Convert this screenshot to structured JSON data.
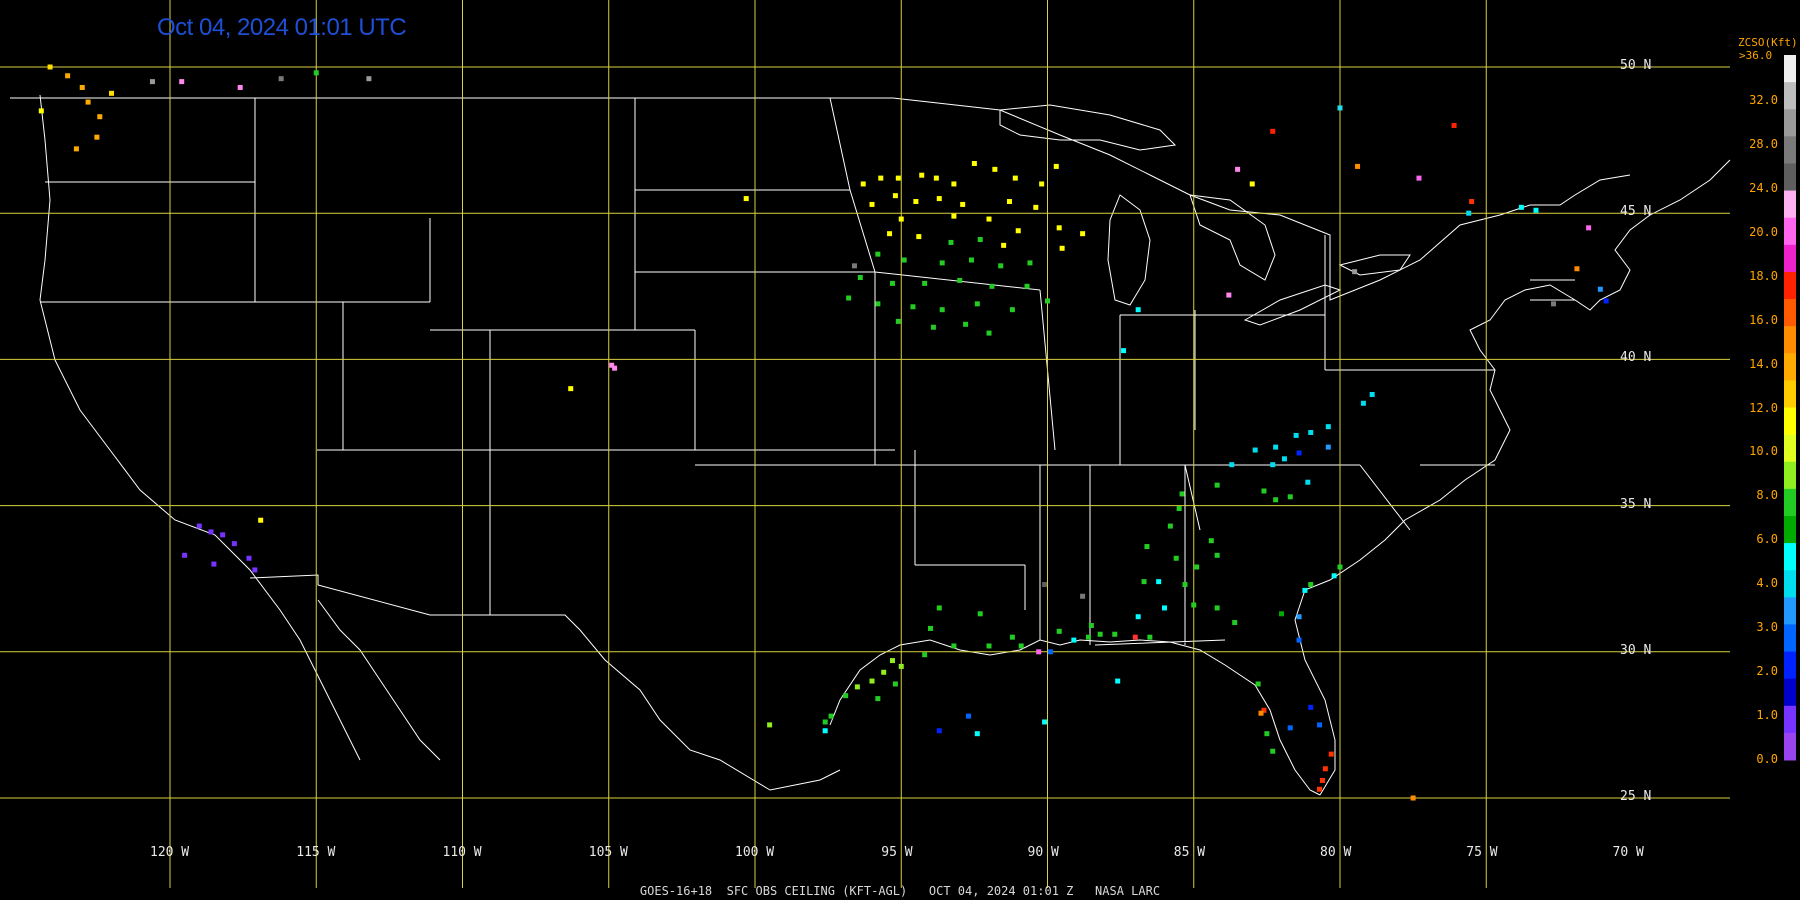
{
  "timestamp": "Oct 04, 2024 01:01 UTC",
  "footer": "GOES-16+18  SFC OBS CEILING (KFT-AGL)   OCT 04, 2024 01:01 Z   NASA LARC",
  "lat_labels": [
    "50 N",
    "45 N",
    "40 N",
    "35 N",
    "30 N",
    "25 N"
  ],
  "lon_labels": [
    "120 W",
    "115 W",
    "110 W",
    "105 W",
    "100 W",
    "95 W",
    "90 W",
    "85 W",
    "80 W",
    "75 W",
    "70 W"
  ],
  "colorbar": {
    "title": "ZCSO(Kft)",
    "top_label": ">36.0",
    "labels": [
      "32.0",
      "28.0",
      "24.0",
      "20.0",
      "18.0",
      "16.0",
      "14.0",
      "12.0",
      "10.0",
      "8.0",
      "6.0",
      "4.0",
      "3.0",
      "2.0",
      "1.0",
      "0.0"
    ],
    "segment_colors": [
      "#efefef",
      "#bdbdbd",
      "#9a9a9a",
      "#7a7a7a",
      "#5e5e5e",
      "#ffb0f0",
      "#ff66ee",
      "#ee22cc",
      "#ff2200",
      "#ff5a00",
      "#ff8c00",
      "#ffaa00",
      "#ffcc00",
      "#ffff00",
      "#e0ff20",
      "#90ee20",
      "#22cc22",
      "#00aa00",
      "#00ffff",
      "#00ddee",
      "#2299ff",
      "#0066ff",
      "#0022ff",
      "#0000cc",
      "#7733ff",
      "#9944ee"
    ]
  },
  "colors": {
    "grid": "#d9d13f",
    "boundary": "#ffffff",
    "timestamp": "#1e4fd6",
    "scale_text": "#ffa500"
  },
  "observations": [
    {
      "lon": -124.1,
      "lat": 50.0,
      "color": "#ffdd00"
    },
    {
      "lon": -123.5,
      "lat": 49.7,
      "color": "#ffaa00"
    },
    {
      "lon": -123.0,
      "lat": 49.3,
      "color": "#ffaa00"
    },
    {
      "lon": -122.8,
      "lat": 48.8,
      "color": "#ffaa00"
    },
    {
      "lon": -122.4,
      "lat": 48.3,
      "color": "#ffaa00"
    },
    {
      "lon": -122.5,
      "lat": 47.6,
      "color": "#ffaa00"
    },
    {
      "lon": -123.2,
      "lat": 47.2,
      "color": "#ffaa00"
    },
    {
      "lon": -122.0,
      "lat": 49.1,
      "color": "#ffdd00"
    },
    {
      "lon": -124.4,
      "lat": 48.5,
      "color": "#ffff00"
    },
    {
      "lon": -120.6,
      "lat": 49.5,
      "color": "#9a9a9a"
    },
    {
      "lon": -119.6,
      "lat": 49.5,
      "color": "#ff88ee"
    },
    {
      "lon": -117.6,
      "lat": 49.3,
      "color": "#ff88ee"
    },
    {
      "lon": -116.2,
      "lat": 49.6,
      "color": "#7a7a7a"
    },
    {
      "lon": -115.0,
      "lat": 49.8,
      "color": "#22cc22"
    },
    {
      "lon": -113.2,
      "lat": 49.6,
      "color": "#9a9a9a"
    },
    {
      "lon": -119.0,
      "lat": 34.3,
      "color": "#7733ff"
    },
    {
      "lon": -118.6,
      "lat": 34.1,
      "color": "#7733ff"
    },
    {
      "lon": -118.2,
      "lat": 34.0,
      "color": "#7733ff"
    },
    {
      "lon": -117.8,
      "lat": 33.7,
      "color": "#7733ff"
    },
    {
      "lon": -117.3,
      "lat": 33.2,
      "color": "#7733ff"
    },
    {
      "lon": -117.1,
      "lat": 32.8,
      "color": "#7733ff"
    },
    {
      "lon": -119.5,
      "lat": 33.3,
      "color": "#7733ff"
    },
    {
      "lon": -118.5,
      "lat": 33.0,
      "color": "#7733ff"
    },
    {
      "lon": -116.9,
      "lat": 34.5,
      "color": "#ffff00"
    },
    {
      "lon": -104.9,
      "lat": 39.8,
      "color": "#ff88ee"
    },
    {
      "lon": -104.8,
      "lat": 39.7,
      "color": "#ff88ee"
    },
    {
      "lon": -106.3,
      "lat": 39.0,
      "color": "#ffff00"
    },
    {
      "lon": -100.3,
      "lat": 45.5,
      "color": "#ffff00"
    },
    {
      "lon": -96.3,
      "lat": 46.0,
      "color": "#ffff00"
    },
    {
      "lon": -95.7,
      "lat": 46.2,
      "color": "#ffff00"
    },
    {
      "lon": -95.1,
      "lat": 46.2,
      "color": "#ffff00"
    },
    {
      "lon": -94.3,
      "lat": 46.3,
      "color": "#ffff00"
    },
    {
      "lon": -93.8,
      "lat": 46.2,
      "color": "#ffff00"
    },
    {
      "lon": -93.2,
      "lat": 46.0,
      "color": "#ffff00"
    },
    {
      "lon": -92.5,
      "lat": 46.7,
      "color": "#ffff00"
    },
    {
      "lon": -91.8,
      "lat": 46.5,
      "color": "#ffff00"
    },
    {
      "lon": -91.1,
      "lat": 46.2,
      "color": "#ffff00"
    },
    {
      "lon": -90.2,
      "lat": 46.0,
      "color": "#ffff00"
    },
    {
      "lon": -89.7,
      "lat": 46.6,
      "color": "#ffff00"
    },
    {
      "lon": -96.0,
      "lat": 45.3,
      "color": "#ffff00"
    },
    {
      "lon": -95.2,
      "lat": 45.6,
      "color": "#ffff00"
    },
    {
      "lon": -94.5,
      "lat": 45.4,
      "color": "#ffff00"
    },
    {
      "lon": -93.7,
      "lat": 45.5,
      "color": "#ffff00"
    },
    {
      "lon": -92.9,
      "lat": 45.3,
      "color": "#ffff00"
    },
    {
      "lon": -91.3,
      "lat": 45.4,
      "color": "#ffff00"
    },
    {
      "lon": -90.4,
      "lat": 45.2,
      "color": "#ffff00"
    },
    {
      "lon": -95.0,
      "lat": 44.8,
      "color": "#ffff00"
    },
    {
      "lon": -93.2,
      "lat": 44.9,
      "color": "#ffff00"
    },
    {
      "lon": -92.0,
      "lat": 44.8,
      "color": "#ffff00"
    },
    {
      "lon": -91.0,
      "lat": 44.4,
      "color": "#ffff00"
    },
    {
      "lon": -89.6,
      "lat": 44.5,
      "color": "#ffff00"
    },
    {
      "lon": -88.8,
      "lat": 44.3,
      "color": "#ffff00"
    },
    {
      "lon": -89.5,
      "lat": 43.8,
      "color": "#ffff00"
    },
    {
      "lon": -95.4,
      "lat": 44.3,
      "color": "#ffff00"
    },
    {
      "lon": -94.4,
      "lat": 44.2,
      "color": "#ffff00"
    },
    {
      "lon": -91.5,
      "lat": 43.9,
      "color": "#ffff00"
    },
    {
      "lon": -93.3,
      "lat": 44.0,
      "color": "#22cc22"
    },
    {
      "lon": -92.3,
      "lat": 44.1,
      "color": "#22cc22"
    },
    {
      "lon": -95.8,
      "lat": 43.6,
      "color": "#22cc22"
    },
    {
      "lon": -94.9,
      "lat": 43.4,
      "color": "#22cc22"
    },
    {
      "lon": -93.6,
      "lat": 43.3,
      "color": "#22cc22"
    },
    {
      "lon": -92.6,
      "lat": 43.4,
      "color": "#22cc22"
    },
    {
      "lon": -91.6,
      "lat": 43.2,
      "color": "#22cc22"
    },
    {
      "lon": -90.6,
      "lat": 43.3,
      "color": "#22cc22"
    },
    {
      "lon": -96.4,
      "lat": 42.8,
      "color": "#22cc22"
    },
    {
      "lon": -95.3,
      "lat": 42.6,
      "color": "#22cc22"
    },
    {
      "lon": -94.2,
      "lat": 42.6,
      "color": "#22cc22"
    },
    {
      "lon": -93.0,
      "lat": 42.7,
      "color": "#22cc22"
    },
    {
      "lon": -91.9,
      "lat": 42.5,
      "color": "#22cc22"
    },
    {
      "lon": -90.7,
      "lat": 42.5,
      "color": "#22cc22"
    },
    {
      "lon": -96.8,
      "lat": 42.1,
      "color": "#22cc22"
    },
    {
      "lon": -95.8,
      "lat": 41.9,
      "color": "#22cc22"
    },
    {
      "lon": -94.6,
      "lat": 41.8,
      "color": "#22cc22"
    },
    {
      "lon": -93.6,
      "lat": 41.7,
      "color": "#22cc22"
    },
    {
      "lon": -92.4,
      "lat": 41.9,
      "color": "#22cc22"
    },
    {
      "lon": -91.2,
      "lat": 41.7,
      "color": "#22cc22"
    },
    {
      "lon": -95.1,
      "lat": 41.3,
      "color": "#22cc22"
    },
    {
      "lon": -93.9,
      "lat": 41.1,
      "color": "#22cc22"
    },
    {
      "lon": -92.8,
      "lat": 41.2,
      "color": "#22cc22"
    },
    {
      "lon": -92.0,
      "lat": 40.9,
      "color": "#22cc22"
    },
    {
      "lon": -96.6,
      "lat": 43.2,
      "color": "#7a7a7a"
    },
    {
      "lon": -90.0,
      "lat": 42.0,
      "color": "#22cc22"
    },
    {
      "lon": -83.5,
      "lat": 46.5,
      "color": "#ff88ee"
    },
    {
      "lon": -83.0,
      "lat": 46.0,
      "color": "#ffff00"
    },
    {
      "lon": -82.3,
      "lat": 47.8,
      "color": "#ff2200"
    },
    {
      "lon": -80.0,
      "lat": 48.6,
      "color": "#22ddee"
    },
    {
      "lon": -79.4,
      "lat": 46.6,
      "color": "#ff8c00"
    },
    {
      "lon": -76.1,
      "lat": 48.0,
      "color": "#ff2200"
    },
    {
      "lon": -77.3,
      "lat": 46.2,
      "color": "#ff66ee"
    },
    {
      "lon": -75.5,
      "lat": 45.4,
      "color": "#ff3300"
    },
    {
      "lon": -73.8,
      "lat": 45.2,
      "color": "#00ffff"
    },
    {
      "lon": -73.3,
      "lat": 45.1,
      "color": "#00ffff"
    },
    {
      "lon": -71.5,
      "lat": 44.5,
      "color": "#ff66ee"
    },
    {
      "lon": -71.9,
      "lat": 43.1,
      "color": "#ff8c00"
    },
    {
      "lon": -71.1,
      "lat": 42.4,
      "color": "#2299ff"
    },
    {
      "lon": -70.9,
      "lat": 42.0,
      "color": "#0022ff"
    },
    {
      "lon": -72.7,
      "lat": 41.9,
      "color": "#7a7a7a"
    },
    {
      "lon": -79.5,
      "lat": 43.0,
      "color": "#9a9a9a"
    },
    {
      "lon": -83.8,
      "lat": 42.2,
      "color": "#ff88ee"
    },
    {
      "lon": -86.9,
      "lat": 41.7,
      "color": "#00ffff"
    },
    {
      "lon": -87.4,
      "lat": 40.3,
      "color": "#00ffff"
    },
    {
      "lon": -78.9,
      "lat": 38.8,
      "color": "#00ddee"
    },
    {
      "lon": -79.2,
      "lat": 38.5,
      "color": "#00ddee"
    },
    {
      "lon": -80.4,
      "lat": 37.7,
      "color": "#00ddee"
    },
    {
      "lon": -81.0,
      "lat": 37.5,
      "color": "#00ddee"
    },
    {
      "lon": -81.5,
      "lat": 37.4,
      "color": "#00ddee"
    },
    {
      "lon": -82.2,
      "lat": 37.0,
      "color": "#00ddee"
    },
    {
      "lon": -82.9,
      "lat": 36.9,
      "color": "#00ddee"
    },
    {
      "lon": -80.4,
      "lat": 37.0,
      "color": "#2299ff"
    },
    {
      "lon": -81.4,
      "lat": 36.8,
      "color": "#0022ff"
    },
    {
      "lon": -81.9,
      "lat": 36.6,
      "color": "#00ddee"
    },
    {
      "lon": -83.7,
      "lat": 36.4,
      "color": "#00ddee"
    },
    {
      "lon": -82.3,
      "lat": 36.4,
      "color": "#00ddee"
    },
    {
      "lon": -81.1,
      "lat": 35.8,
      "color": "#00ddee"
    },
    {
      "lon": -82.6,
      "lat": 35.5,
      "color": "#22cc22"
    },
    {
      "lon": -82.2,
      "lat": 35.2,
      "color": "#22cc22"
    },
    {
      "lon": -81.7,
      "lat": 35.3,
      "color": "#22cc22"
    },
    {
      "lon": -84.2,
      "lat": 35.7,
      "color": "#22cc22"
    },
    {
      "lon": -85.4,
      "lat": 35.4,
      "color": "#22cc22"
    },
    {
      "lon": -85.5,
      "lat": 34.9,
      "color": "#22cc22"
    },
    {
      "lon": -85.8,
      "lat": 34.3,
      "color": "#22cc22"
    },
    {
      "lon": -86.6,
      "lat": 33.6,
      "color": "#22cc22"
    },
    {
      "lon": -85.6,
      "lat": 33.2,
      "color": "#22cc22"
    },
    {
      "lon": -84.4,
      "lat": 33.8,
      "color": "#22cc22"
    },
    {
      "lon": -84.2,
      "lat": 33.3,
      "color": "#22cc22"
    },
    {
      "lon": -84.9,
      "lat": 32.9,
      "color": "#22cc22"
    },
    {
      "lon": -85.3,
      "lat": 32.3,
      "color": "#22cc22"
    },
    {
      "lon": -86.2,
      "lat": 32.4,
      "color": "#00ffff"
    },
    {
      "lon": -86.0,
      "lat": 31.5,
      "color": "#00ffff"
    },
    {
      "lon": -86.9,
      "lat": 31.2,
      "color": "#00ffff"
    },
    {
      "lon": -86.7,
      "lat": 32.4,
      "color": "#22cc22"
    },
    {
      "lon": -85.0,
      "lat": 31.6,
      "color": "#22cc22"
    },
    {
      "lon": -84.2,
      "lat": 31.5,
      "color": "#22cc22"
    },
    {
      "lon": -83.6,
      "lat": 31.0,
      "color": "#22cc22"
    },
    {
      "lon": -82.0,
      "lat": 31.3,
      "color": "#00aa00"
    },
    {
      "lon": -81.4,
      "lat": 31.2,
      "color": "#2299ff"
    },
    {
      "lon": -81.4,
      "lat": 30.4,
      "color": "#0066ff"
    },
    {
      "lon": -80.0,
      "lat": 32.9,
      "color": "#22cc22"
    },
    {
      "lon": -80.2,
      "lat": 32.6,
      "color": "#00ffff"
    },
    {
      "lon": -81.2,
      "lat": 32.1,
      "color": "#00ffff"
    },
    {
      "lon": -81.0,
      "lat": 32.3,
      "color": "#22cc22"
    },
    {
      "lon": -87.0,
      "lat": 30.5,
      "color": "#ff3333"
    },
    {
      "lon": -86.5,
      "lat": 30.5,
      "color": "#22cc22"
    },
    {
      "lon": -87.7,
      "lat": 30.6,
      "color": "#22cc22"
    },
    {
      "lon": -88.2,
      "lat": 30.6,
      "color": "#22cc22"
    },
    {
      "lon": -88.6,
      "lat": 30.5,
      "color": "#22cc22"
    },
    {
      "lon": -89.1,
      "lat": 30.4,
      "color": "#00ffff"
    },
    {
      "lon": -89.9,
      "lat": 30.0,
      "color": "#0066ff"
    },
    {
      "lon": -90.3,
      "lat": 30.0,
      "color": "#ff66ee"
    },
    {
      "lon": -91.2,
      "lat": 30.5,
      "color": "#22cc22"
    },
    {
      "lon": -90.9,
      "lat": 30.2,
      "color": "#22cc22"
    },
    {
      "lon": -89.6,
      "lat": 30.7,
      "color": "#22cc22"
    },
    {
      "lon": -88.5,
      "lat": 30.9,
      "color": "#22cc22"
    },
    {
      "lon": -93.2,
      "lat": 30.2,
      "color": "#22cc22"
    },
    {
      "lon": -92.0,
      "lat": 30.2,
      "color": "#22cc22"
    },
    {
      "lon": -92.3,
      "lat": 31.3,
      "color": "#22cc22"
    },
    {
      "lon": -93.7,
      "lat": 31.5,
      "color": "#22cc22"
    },
    {
      "lon": -94.0,
      "lat": 30.8,
      "color": "#22cc22"
    },
    {
      "lon": -94.2,
      "lat": 29.9,
      "color": "#22cc22"
    },
    {
      "lon": -95.0,
      "lat": 29.5,
      "color": "#90ee20"
    },
    {
      "lon": -95.3,
      "lat": 29.7,
      "color": "#90ee20"
    },
    {
      "lon": -95.6,
      "lat": 29.3,
      "color": "#90ee20"
    },
    {
      "lon": -96.0,
      "lat": 29.0,
      "color": "#90ee20"
    },
    {
      "lon": -96.5,
      "lat": 28.8,
      "color": "#90ee20"
    },
    {
      "lon": -96.9,
      "lat": 28.5,
      "color": "#22cc22"
    },
    {
      "lon": -97.4,
      "lat": 27.8,
      "color": "#22cc22"
    },
    {
      "lon": -97.6,
      "lat": 27.6,
      "color": "#22cc22"
    },
    {
      "lon": -95.8,
      "lat": 28.4,
      "color": "#22cc22"
    },
    {
      "lon": -95.2,
      "lat": 28.9,
      "color": "#22cc22"
    },
    {
      "lon": -99.5,
      "lat": 27.5,
      "color": "#90ee20"
    },
    {
      "lon": -97.6,
      "lat": 27.3,
      "color": "#00ffff"
    },
    {
      "lon": -93.7,
      "lat": 27.3,
      "color": "#0022ff"
    },
    {
      "lon": -92.7,
      "lat": 27.8,
      "color": "#0066ff"
    },
    {
      "lon": -92.4,
      "lat": 27.2,
      "color": "#00ffff"
    },
    {
      "lon": -90.1,
      "lat": 27.6,
      "color": "#00ffff"
    },
    {
      "lon": -87.6,
      "lat": 29.0,
      "color": "#00ffff"
    },
    {
      "lon": -88.8,
      "lat": 31.9,
      "color": "#7a7a7a"
    },
    {
      "lon": -90.1,
      "lat": 32.3,
      "color": "#5e5e5e"
    },
    {
      "lon": -82.6,
      "lat": 28.0,
      "color": "#ff3300"
    },
    {
      "lon": -82.7,
      "lat": 27.9,
      "color": "#ff8c00"
    },
    {
      "lon": -82.5,
      "lat": 27.2,
      "color": "#22cc22"
    },
    {
      "lon": -82.8,
      "lat": 28.9,
      "color": "#22cc22"
    },
    {
      "lon": -82.3,
      "lat": 26.6,
      "color": "#22cc22"
    },
    {
      "lon": -81.7,
      "lat": 27.4,
      "color": "#0066ff"
    },
    {
      "lon": -81.0,
      "lat": 28.1,
      "color": "#0022ff"
    },
    {
      "lon": -80.7,
      "lat": 27.5,
      "color": "#0066ff"
    },
    {
      "lon": -80.5,
      "lat": 26.0,
      "color": "#ff3300"
    },
    {
      "lon": -80.6,
      "lat": 25.6,
      "color": "#ff3300"
    },
    {
      "lon": -80.7,
      "lat": 25.3,
      "color": "#ff3300"
    },
    {
      "lon": -80.3,
      "lat": 26.5,
      "color": "#ff3300"
    },
    {
      "lon": -77.5,
      "lat": 25.0,
      "color": "#ff8c00"
    },
    {
      "lon": -75.6,
      "lat": 45.0,
      "color": "#00ddee"
    }
  ]
}
